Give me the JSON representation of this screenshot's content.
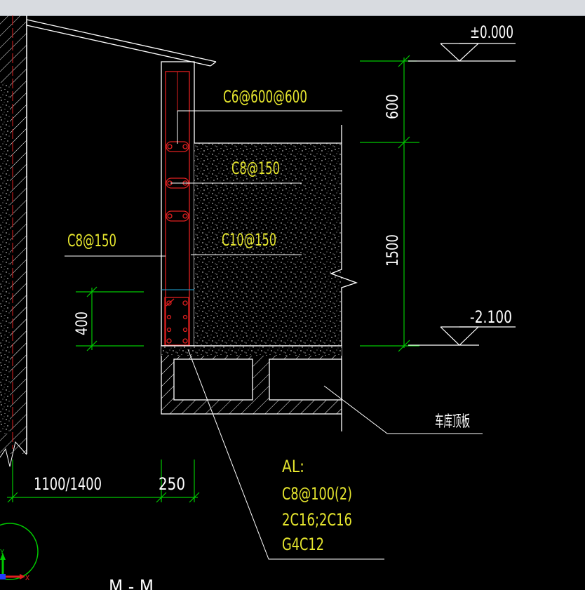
{
  "elevations": {
    "top": "±0.000",
    "bottom": "-2.100"
  },
  "dimensions": {
    "d600": "600",
    "d1500": "1500",
    "d400": "400",
    "d1100": "1100/1400",
    "d250": "250"
  },
  "rebar_labels": {
    "tie": "C6@600@600",
    "horizontal_c8": "C8@150",
    "vertical_c10": "C10@150",
    "outer_c8": "C8@150"
  },
  "beam_note": {
    "title": "AL:",
    "stirrup": "C8@100(2)",
    "main_bars": "2C16;2C16",
    "side_bars": "G4C12"
  },
  "garage_roof_label": "车库顶板",
  "section_mark": "M - M",
  "ucs": {
    "y": "Y",
    "x": "X"
  },
  "colors": {
    "background": "#000000",
    "text": "#e6e62e",
    "dimension": "#00c800",
    "rebar": "#e02020",
    "line": "#ffffff"
  }
}
